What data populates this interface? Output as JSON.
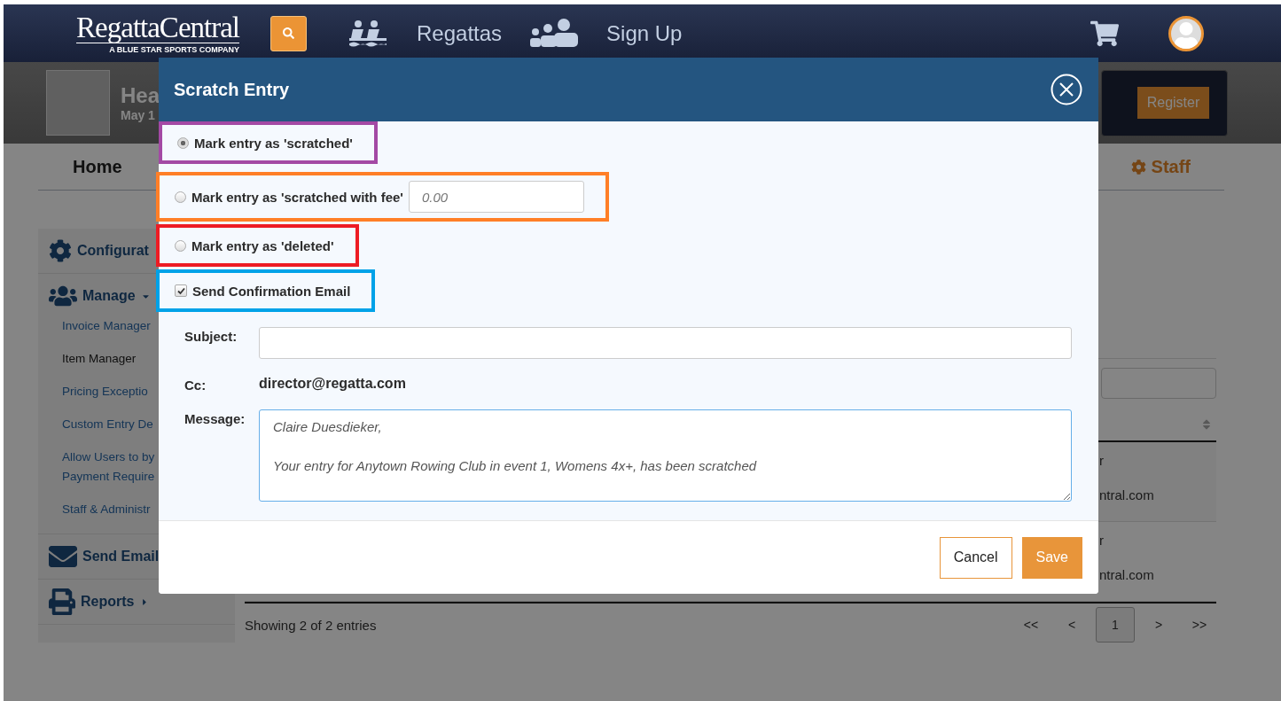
{
  "header": {
    "logo": "RegattaCentral",
    "tagline": "A BLUE STAR SPORTS COMPANY",
    "nav": [
      {
        "label": "Regattas",
        "kind": "boats"
      },
      {
        "label": "Sign Up",
        "kind": "group"
      }
    ]
  },
  "event": {
    "title": "Hea",
    "subtitle": "May 1",
    "register_button": "Register"
  },
  "tabs": [
    {
      "label": "Home",
      "selected": false
    },
    {
      "label": "Staff",
      "selected": true
    }
  ],
  "sidebar": [
    {
      "label": "Configurat",
      "kind": "gear"
    },
    {
      "label": "Manage",
      "kind": "people",
      "expanded": true,
      "children": [
        {
          "label": "Invoice Manager",
          "selected": false
        },
        {
          "label": "Item Manager",
          "selected": true
        },
        {
          "label": "Pricing Exceptio",
          "selected": false
        },
        {
          "label": "Custom Entry De",
          "selected": false
        },
        {
          "label": "Allow Users to by\nPayment Require",
          "selected": false
        },
        {
          "label": "Staff & Administr",
          "selected": false
        }
      ]
    },
    {
      "label": "Send Email",
      "kind": "mail"
    },
    {
      "label": "Reports",
      "kind": "printer",
      "expanded": false
    }
  ],
  "table": {
    "rows": [
      {
        "column_1": "r",
        "column_2": "ntral.com"
      },
      {
        "column_1": "r",
        "column_2": "ntral.com"
      }
    ],
    "footer": "Showing 2 of 2 entries",
    "pagination": [
      {
        "label": "<<",
        "selected": false
      },
      {
        "label": "<",
        "selected": false
      },
      {
        "label": "1",
        "selected": true
      },
      {
        "label": ">",
        "selected": false
      },
      {
        "label": ">>",
        "selected": false
      }
    ]
  },
  "modal": {
    "title": "Scratch Entry",
    "options": [
      {
        "kind": "radio",
        "label": "Mark entry as 'scratched'",
        "selected": true,
        "color": "#a349a4"
      },
      {
        "kind": "radio",
        "label": "Mark entry as 'scratched with fee'",
        "selected": false,
        "color": "#ff7f27",
        "fee_placeholder": "0.00"
      },
      {
        "kind": "radio",
        "label": "Mark entry as 'deleted'",
        "selected": false,
        "color": "#ed1c24"
      },
      {
        "kind": "checkbox",
        "label": "Send Confirmation Email",
        "checked": true,
        "color": "#00a2e8"
      }
    ],
    "subject_label": "Subject:",
    "cc_label": "Cc:",
    "cc_value": "director@regatta.com",
    "message_label": "Message:",
    "message_value": "Claire Duesdieker,\n\nYour entry for Anytown Rowing Club in event 1, Womens 4x+, has been scratched",
    "buttons": [
      {
        "label": "Cancel",
        "kind": "secondary"
      },
      {
        "label": "Save",
        "kind": "primary"
      }
    ]
  }
}
